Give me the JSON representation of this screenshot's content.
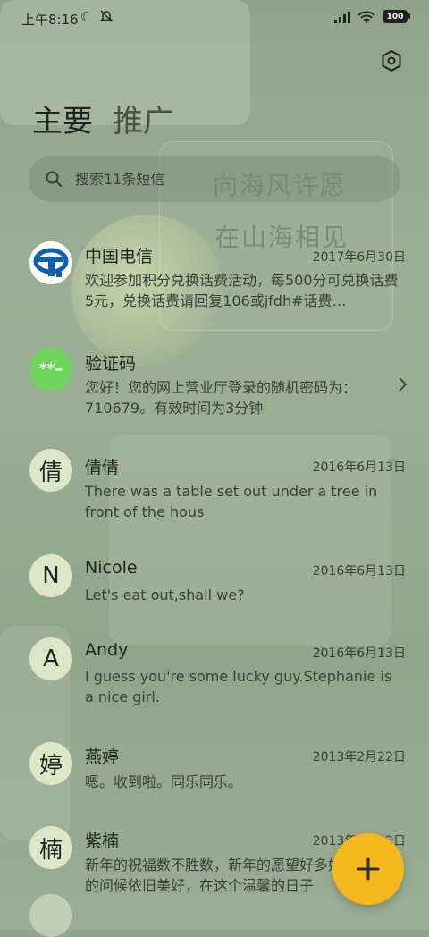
{
  "status": {
    "time": "上午8:16",
    "battery": "100"
  },
  "tabs": [
    {
      "label": "主要"
    },
    {
      "label": "推广"
    }
  ],
  "search": {
    "placeholder": "搜索11条短信"
  },
  "background_text": {
    "line1": "向海风许愿",
    "line2": "在山海相见"
  },
  "conversations": [
    {
      "name": "中国电信",
      "date": "2017年6月30日",
      "preview": "欢迎参加积分兑换话费活动，每500分可兑换话费5元，兑换话费请回复106或jfdh#话费…",
      "avatar_kind": "logo"
    },
    {
      "name": "验证码",
      "date": "",
      "preview": "您好！您的网上营业厅登录的随机密码为：710679。有效时间为3分钟",
      "avatar_text": "**–",
      "avatar_kind": "code"
    },
    {
      "name": "倩倩",
      "date": "2016年6月13日",
      "preview": "There was a table set out under a tree in front of the hous",
      "avatar_text": "倩"
    },
    {
      "name": "Nicole",
      "date": "2016年6月13日",
      "preview": "Let's eat out,shall we?",
      "avatar_text": "N"
    },
    {
      "name": "Andy",
      "date": "2016年6月13日",
      "preview": "I guess you're some lucky guy.Stephanie is a nice girl.",
      "avatar_text": "A"
    },
    {
      "name": "燕婷",
      "date": "2013年2月22日",
      "preview": "嗯。收到啦。同乐同乐。",
      "avatar_text": "婷"
    },
    {
      "name": "紫楠",
      "date": "2013年2月22日",
      "preview": "新年的祝福数不胜数，新年的愿望好多好多，新年的问候依旧美好，在这个温馨的日子",
      "avatar_text": "楠"
    }
  ],
  "colors": {
    "fab": "#f5b81c",
    "code_avatar": "#6fd65c",
    "telecom_blue": "#0d5fb0"
  }
}
